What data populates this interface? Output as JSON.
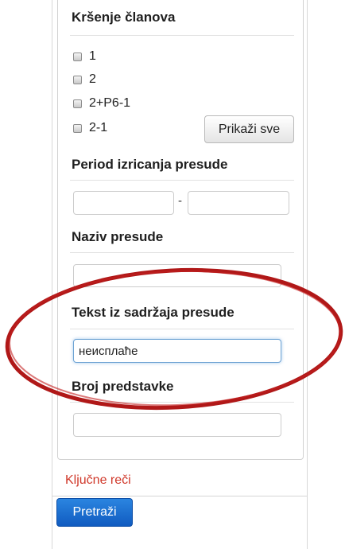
{
  "sections": {
    "violations_title": "Kršenje članova",
    "period_title": "Period izricanja presude",
    "name_title": "Naziv presude",
    "text_title": "Tekst iz sadržaja presude",
    "application_title": "Broj predstavke"
  },
  "articles": {
    "options": [
      {
        "label": "1",
        "checked": false
      },
      {
        "label": "2",
        "checked": false
      },
      {
        "label": "2+P6-1",
        "checked": false
      },
      {
        "label": "2-1",
        "checked": false
      }
    ],
    "show_all_label": "Prikaži sve"
  },
  "period": {
    "from_value": "",
    "to_value": "",
    "separator": "-"
  },
  "name_field": {
    "value": ""
  },
  "text_field": {
    "value": "неисплаће"
  },
  "application_field": {
    "value": ""
  },
  "keywords_link": "Ključne reči",
  "search_button_label": "Pretraži",
  "colors": {
    "keywords_link": "#d0382a",
    "search_button": "#1a6fd0",
    "annotation_ellipse": "#b01818",
    "focus_border": "#6ea3d4"
  }
}
